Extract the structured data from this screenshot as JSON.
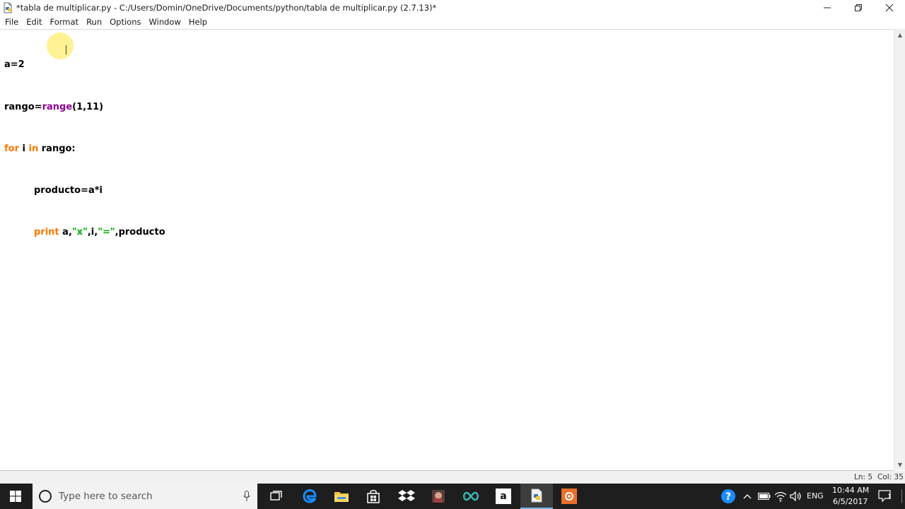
{
  "window": {
    "title": "*tabla de multiplicar.py - C:/Users/Domin/OneDrive/Documents/python/tabla de multiplicar.py (2.7.13)*"
  },
  "menu": [
    "File",
    "Edit",
    "Format",
    "Run",
    "Options",
    "Window",
    "Help"
  ],
  "code": {
    "l1": "a=2",
    "l2_var": "rango=",
    "l2_builtin": "range",
    "l2_rest": "(1,11)",
    "l3_kw1": "for",
    "l3_mid": " i ",
    "l3_kw2": "in",
    "l3_rest": " rango:",
    "l4": "producto=a*i",
    "l5_kw": "print",
    "l5_a": " a,",
    "l5_s1": "\"x\"",
    "l5_b": ",i,",
    "l5_s2": "\"=\"",
    "l5_c": ",producto"
  },
  "status": {
    "ln": "Ln: 5",
    "col": "Col: 35"
  },
  "taskbar": {
    "search_placeholder": "Type here to search",
    "lang": "ENG",
    "time": "10:44 AM",
    "date": "6/5/2017",
    "notifications": "1"
  },
  "colors": {
    "keyword": "#ff7700",
    "builtin": "#900090",
    "string": "#00aa00",
    "taskbar": "#1e1e1e"
  }
}
